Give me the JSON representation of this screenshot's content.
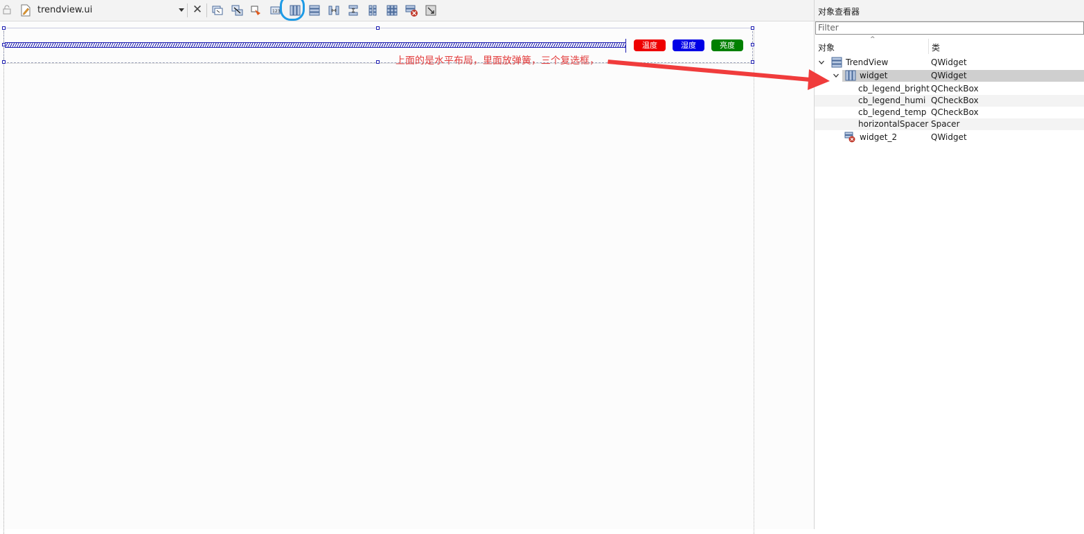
{
  "toolbar": {
    "file_name": "trendview.ui",
    "buttons": [
      {
        "name": "edit-widgets-icon"
      },
      {
        "name": "edit-signals-slots-icon"
      },
      {
        "name": "edit-buddies-icon"
      },
      {
        "name": "edit-tab-order-icon"
      },
      {
        "name": "layout-horizontal-icon"
      },
      {
        "name": "layout-vertical-icon"
      },
      {
        "name": "layout-horizontal-splitter-icon"
      },
      {
        "name": "layout-vertical-splitter-icon"
      },
      {
        "name": "layout-form-icon"
      },
      {
        "name": "layout-grid-icon"
      },
      {
        "name": "break-layout-icon"
      },
      {
        "name": "adjust-size-icon"
      }
    ]
  },
  "canvas": {
    "checkboxes": [
      {
        "label": "温度",
        "color": "#ee0000"
      },
      {
        "label": "湿度",
        "color": "#0000e6"
      },
      {
        "label": "亮度",
        "color": "#008000"
      }
    ],
    "annotation": "上面的是水平布局，里面放弹簧，三个复选框，"
  },
  "object_inspector": {
    "title": "对象查看器",
    "filter_placeholder": "Filter",
    "col_object": "对象",
    "col_class": "类",
    "rows": [
      {
        "name": "TrendView",
        "cls": "QWidget"
      },
      {
        "name": "widget",
        "cls": "QWidget"
      },
      {
        "name": "cb_legend_bright",
        "cls": "QCheckBox"
      },
      {
        "name": "cb_legend_humi",
        "cls": "QCheckBox"
      },
      {
        "name": "cb_legend_temp",
        "cls": "QCheckBox"
      },
      {
        "name": "horizontalSpacer",
        "cls": "Spacer"
      },
      {
        "name": "widget_2",
        "cls": "QWidget"
      }
    ]
  },
  "colors": {
    "annotation": "#e23b3b",
    "highlight_circle": "#1e9be6",
    "spacer": "#1b1bb0"
  }
}
